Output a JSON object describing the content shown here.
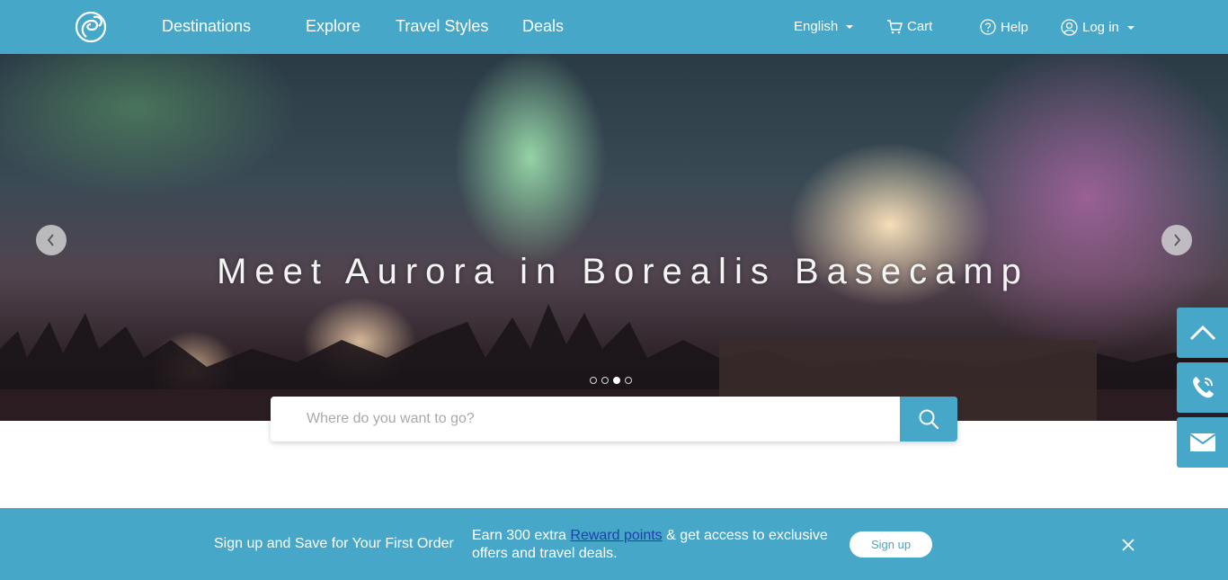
{
  "header": {
    "nav": [
      "Destinations",
      "Explore",
      "Travel Styles",
      "Deals"
    ],
    "language": "English",
    "cart": "Cart",
    "help": "Help",
    "login": "Log in"
  },
  "hero": {
    "title": "Meet Aurora in Borealis Basecamp",
    "slides_total": 4,
    "active_slide": 3
  },
  "search": {
    "placeholder": "Where do you want to go?"
  },
  "signup": {
    "title": "Sign up and Save for Your First Order",
    "desc_before": "Earn 300 extra ",
    "desc_link": "Reward points",
    "desc_after": " & get access to exclusive offers and travel deals.",
    "button": "Sign up"
  },
  "colors": {
    "brand": "#46a7c8",
    "link": "#1f3fae"
  },
  "icons": [
    "logo-icon",
    "cart-icon",
    "help-icon",
    "user-icon",
    "chevron-left-icon",
    "chevron-right-icon",
    "search-icon",
    "chevron-up-icon",
    "phone-icon",
    "mail-icon",
    "close-icon"
  ]
}
